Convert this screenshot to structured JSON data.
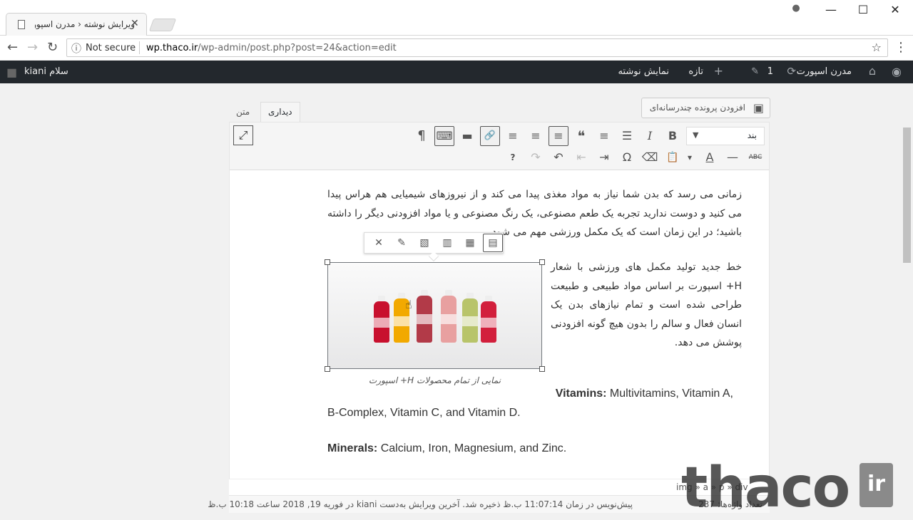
{
  "browser": {
    "tab_title": "ویرایش نوشته ‹ مدرن اسپورت",
    "close": "✕",
    "security_label": "Not secure",
    "url_host": "wp.thaco.ir",
    "url_path": "/wp-admin/post.php?post=24&action=edit",
    "icons": {
      "back": "←",
      "forward": "→",
      "reload": "↻",
      "info": "ⓘ",
      "star": "☆",
      "kebab": "⋮",
      "account": "●",
      "minimize": "—",
      "maximize": "☐",
      "close_window": "✕"
    }
  },
  "adminbar": {
    "site_name": "مدرن اسپورت",
    "updates_count": "1",
    "new_label": "تازه",
    "view_post": "نمایش نوشته",
    "greeting": "سلام kiani",
    "icons": {
      "wp": "◉",
      "home": "⌂",
      "updates": "⟳",
      "comments": "✎",
      "plus": "+",
      "avatar": "■"
    }
  },
  "editor": {
    "add_media": "افزودن پرونده چندرسانه‌ای",
    "add_media_icon": "▣",
    "tab_visual": "دیداری",
    "tab_text": "متن",
    "format_value": "بند",
    "format_chevron": "▼",
    "toolbar_row1": [
      "B",
      "I",
      "☰",
      "≡",
      "❝",
      "≡",
      "≡",
      "≡",
      "🔗",
      "▬",
      "⌨",
      "¶"
    ],
    "toolbar_row2": [
      "ABC",
      "—",
      "A",
      "▾",
      "📋",
      "⌫",
      "Ω",
      "⇥",
      "⇤",
      "↶",
      "↷",
      "?"
    ],
    "fullscreen_icon": "⤢"
  },
  "content": {
    "paragraph1": "زمانی می رسد که بدن شما نیاز به مواد مغذی پیدا می کند و از نیروزهای شیمیایی هم هراس پیدا می کنید و دوست ندارید تجربه یک طعم مصنوعی، یک رنگ مصنوعی و یا مواد افزودنی دیگر را داشته باشید؛ در این زمان است که یک مکمل ورزشی مهم می شود.",
    "paragraph2": "خط جدید تولید مکمل های ورزشی با شعار H+ اسپورت بر اساس مواد طبیعی و طبیعت طراحی شده است و تمام نیازهای بدن یک انسان فعال و سالم را بدون هیچ گونه افزودنی پوشش می دهد.",
    "caption": "نمایی از تمام محصولات H+ اسپورت",
    "vitamins_label": "Vitamins:",
    "vitamins_text": " Multivitamins, Vitamin A,",
    "vitamins_text2": "B-Complex, Vitamin C, and Vitamin D.",
    "minerals_label": "Minerals:",
    "minerals_text": " Calcium, Iron, Magnesium, and Zinc."
  },
  "image_toolbar": {
    "icons": [
      "▤",
      "▦",
      "▥",
      "▧",
      "✎",
      "✕"
    ]
  },
  "image": {
    "bottle_colors": [
      "#c8102e",
      "#f2a900",
      "#b23a48",
      "#e8a0a0",
      "#b8c46a",
      "#d21f3c"
    ]
  },
  "statusbar": {
    "path": "img » a » p » div",
    "autosave": "پیش‌نویس در زمان 11:07:14 ب.ظ ذخیره شد. آخرین ویرایش به‌دست kiani در فوریه 19, 2018 ساعت 10:18 ب.ظ",
    "word_count": "تعداد واژه‌ها: 237"
  },
  "watermark": {
    "text": "thaco",
    "suffix": "ir"
  }
}
